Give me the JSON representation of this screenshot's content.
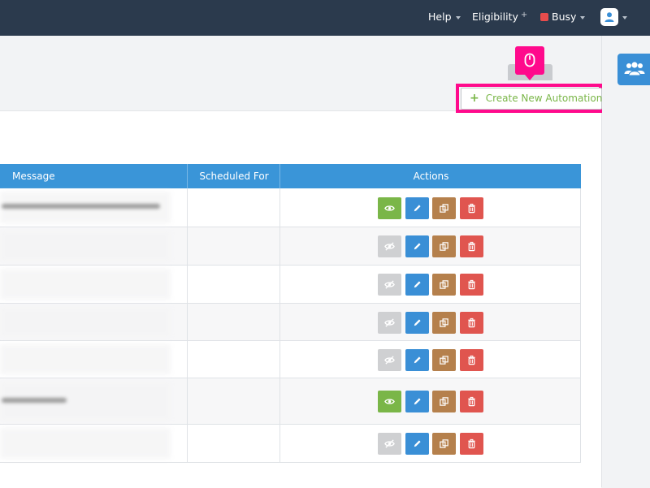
{
  "topbar": {
    "help_label": "Help",
    "eligibility_label": "Eligibility",
    "eligibility_suffix": "+",
    "status_label": "Busy",
    "status_color": "#e74c4c",
    "colors": {
      "navbar": "#2b3a4d"
    }
  },
  "toolbar": {
    "create_label": "Create New Automation",
    "create_icon": "plus-icon",
    "highlight_color": "#ff0a8c"
  },
  "sidepanel": {
    "team_icon": "users-icon",
    "color": "#3a8fd6"
  },
  "table": {
    "headers": [
      "Message",
      "Scheduled For",
      "Actions"
    ],
    "rows": [
      {
        "view_enabled": true
      },
      {
        "view_enabled": false
      },
      {
        "view_enabled": false
      },
      {
        "view_enabled": false
      },
      {
        "view_enabled": false
      },
      {
        "view_enabled": true
      },
      {
        "view_enabled": false
      }
    ],
    "action_icons": [
      "eye-icon",
      "pencil-icon",
      "copy-icon",
      "trash-icon"
    ],
    "colors": {
      "header": "#3a95d8",
      "view": "#7ab648",
      "edit": "#3a8fd6",
      "copy": "#b5804c",
      "delete": "#e0554f"
    }
  }
}
